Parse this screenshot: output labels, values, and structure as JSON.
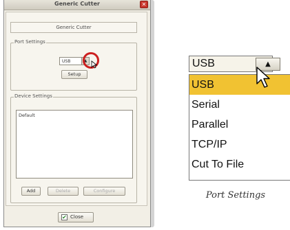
{
  "dialog": {
    "title": "Generic Cutter",
    "close_glyph": "✕",
    "device_name": "Generic Cutter",
    "port_settings": {
      "label": "Port Settings",
      "selected_port": "USB",
      "dropdown_glyph": "▲",
      "setup_label": "Setup"
    },
    "device_settings": {
      "label": "Device Settings",
      "items": [
        "Default"
      ],
      "add_label": "Add",
      "delete_label": "Delete",
      "configure_label": "Configure"
    },
    "close_label": "Close",
    "close_check_glyph": "✔"
  },
  "zoomed_dropdown": {
    "selected_value": "USB",
    "arrow_glyph": "▲",
    "options": [
      "USB",
      "Serial",
      "Parallel",
      "TCP/IP",
      "Cut To File"
    ],
    "highlight_color": "#f1c232"
  },
  "caption": "Port Settings"
}
